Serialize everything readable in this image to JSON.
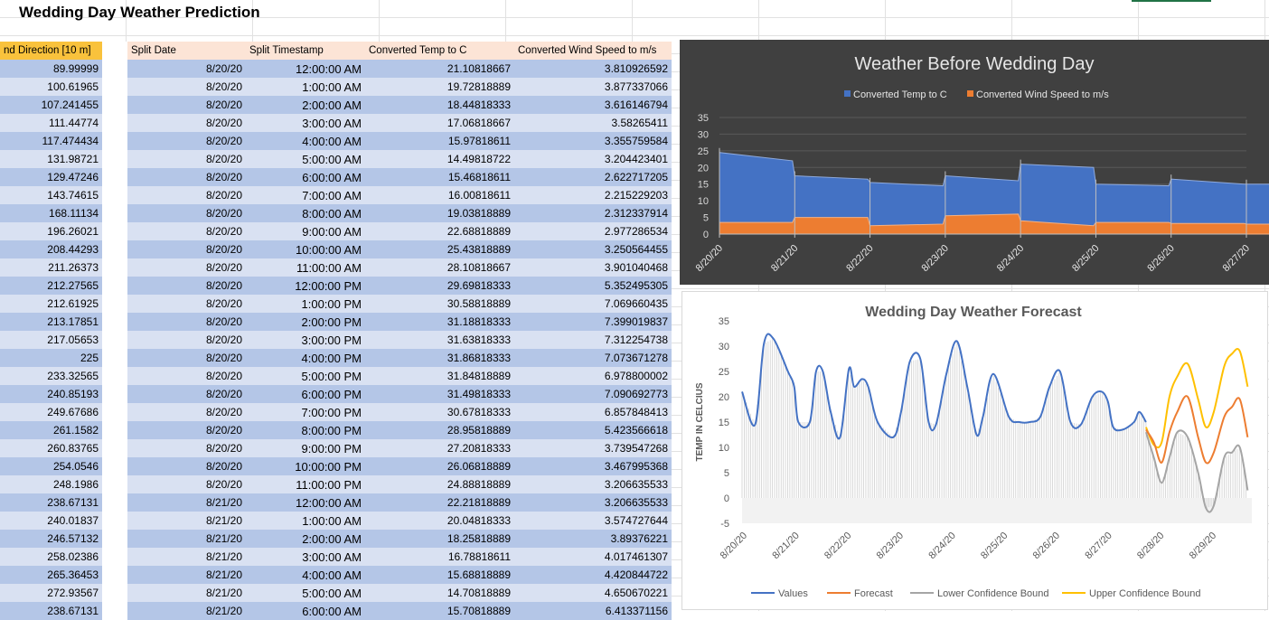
{
  "sheet": {
    "title": "Wedding Day Weather Prediction",
    "headers": [
      "nd Direction [10 m]",
      "Split Date",
      "Split Timestamp",
      "Converted Temp to C",
      "Converted Wind Speed to m/s"
    ],
    "rows": [
      [
        "89.99999",
        "8/20/20",
        "12:00:00 AM",
        "21.10818667",
        "3.810926592"
      ],
      [
        "100.61965",
        "8/20/20",
        "1:00:00 AM",
        "19.72818889",
        "3.877337066"
      ],
      [
        "107.241455",
        "8/20/20",
        "2:00:00 AM",
        "18.44818333",
        "3.616146794"
      ],
      [
        "111.44774",
        "8/20/20",
        "3:00:00 AM",
        "17.06818667",
        "3.58265411"
      ],
      [
        "117.474434",
        "8/20/20",
        "4:00:00 AM",
        "15.97818611",
        "3.355759584"
      ],
      [
        "131.98721",
        "8/20/20",
        "5:00:00 AM",
        "14.49818722",
        "3.204423401"
      ],
      [
        "129.47246",
        "8/20/20",
        "6:00:00 AM",
        "15.46818611",
        "2.622717205"
      ],
      [
        "143.74615",
        "8/20/20",
        "7:00:00 AM",
        "16.00818611",
        "2.215229203"
      ],
      [
        "168.11134",
        "8/20/20",
        "8:00:00 AM",
        "19.03818889",
        "2.312337914"
      ],
      [
        "196.26021",
        "8/20/20",
        "9:00:00 AM",
        "22.68818889",
        "2.977286534"
      ],
      [
        "208.44293",
        "8/20/20",
        "10:00:00 AM",
        "25.43818889",
        "3.250564455"
      ],
      [
        "211.26373",
        "8/20/20",
        "11:00:00 AM",
        "28.10818667",
        "3.901040468"
      ],
      [
        "212.27565",
        "8/20/20",
        "12:00:00 PM",
        "29.69818333",
        "5.352495305"
      ],
      [
        "212.61925",
        "8/20/20",
        "1:00:00 PM",
        "30.58818889",
        "7.069660435"
      ],
      [
        "213.17851",
        "8/20/20",
        "2:00:00 PM",
        "31.18818333",
        "7.399019837"
      ],
      [
        "217.05653",
        "8/20/20",
        "3:00:00 PM",
        "31.63818333",
        "7.312254738"
      ],
      [
        "225",
        "8/20/20",
        "4:00:00 PM",
        "31.86818333",
        "7.073671278"
      ],
      [
        "233.32565",
        "8/20/20",
        "5:00:00 PM",
        "31.84818889",
        "6.978800002"
      ],
      [
        "240.85193",
        "8/20/20",
        "6:00:00 PM",
        "31.49818333",
        "7.090692773"
      ],
      [
        "249.67686",
        "8/20/20",
        "7:00:00 PM",
        "30.67818333",
        "6.857848413"
      ],
      [
        "261.1582",
        "8/20/20",
        "8:00:00 PM",
        "28.95818889",
        "5.423566618"
      ],
      [
        "260.83765",
        "8/20/20",
        "9:00:00 PM",
        "27.20818333",
        "3.739547268"
      ],
      [
        "254.0546",
        "8/20/20",
        "10:00:00 PM",
        "26.06818889",
        "3.467995368"
      ],
      [
        "248.1986",
        "8/20/20",
        "11:00:00 PM",
        "24.88818889",
        "3.206635533"
      ],
      [
        "238.67131",
        "8/21/20",
        "12:00:00 AM",
        "22.21818889",
        "3.206635533"
      ],
      [
        "240.01837",
        "8/21/20",
        "1:00:00 AM",
        "20.04818333",
        "3.574727644"
      ],
      [
        "246.57132",
        "8/21/20",
        "2:00:00 AM",
        "18.25818889",
        "3.89376221"
      ],
      [
        "258.02386",
        "8/21/20",
        "3:00:00 AM",
        "16.78818611",
        "4.017461307"
      ],
      [
        "265.36453",
        "8/21/20",
        "4:00:00 AM",
        "15.68818889",
        "4.420844722"
      ],
      [
        "272.93567",
        "8/21/20",
        "5:00:00 AM",
        "14.70818889",
        "4.650670221"
      ],
      [
        "238.67131",
        "8/21/20",
        "6:00:00 AM",
        "15.70818889",
        "6.413371156"
      ]
    ]
  },
  "chart_data": [
    {
      "type": "area",
      "title": "Weather Before Wedding Day",
      "categories": [
        "8/20/20",
        "8/21/20",
        "8/22/20",
        "8/23/20",
        "8/24/20",
        "8/25/20",
        "8/26/20",
        "8/27/20"
      ],
      "x": [
        0,
        0.97,
        1.0,
        1.97,
        2.0,
        2.97,
        3.0,
        3.97,
        4.0,
        4.97,
        5.0,
        5.97,
        6.0,
        6.97,
        7.0,
        7.97
      ],
      "series": [
        {
          "name": "Converted Temp to C",
          "color": "#4472c4",
          "values": [
            24.5,
            22,
            17.5,
            16.5,
            15.5,
            14.5,
            17.5,
            16,
            21,
            20,
            15,
            14.5,
            16.5,
            15,
            15,
            15
          ]
        },
        {
          "name": "Converted Wind Speed to m/s",
          "color": "#ed7d31",
          "values": [
            3.5,
            3.5,
            5,
            5,
            2.5,
            3,
            5.5,
            6,
            4,
            2.5,
            3.5,
            3.5,
            3.2,
            3.2,
            3,
            3
          ]
        }
      ],
      "ylim": [
        0,
        35
      ],
      "yticks": [
        0,
        5,
        10,
        15,
        20,
        25,
        30,
        35
      ],
      "legend": "top",
      "grid": true
    },
    {
      "type": "line",
      "title": "Wedding Day Weather Forecast",
      "ylabel": "TEMP IN CELCIUS",
      "categories": [
        "8/20/20",
        "8/21/20",
        "8/22/20",
        "8/23/20",
        "8/24/20",
        "8/25/20",
        "8/26/20",
        "8/27/20",
        "8/28/20",
        "8/29/20"
      ],
      "ylim": [
        -5,
        35
      ],
      "yticks": [
        -5,
        0,
        5,
        10,
        15,
        20,
        25,
        30,
        35
      ],
      "series": [
        {
          "name": "Values",
          "color": "#4472c4",
          "x": [
            0,
            0.25,
            0.42,
            0.6,
            0.88,
            1.0,
            1.08,
            1.3,
            1.42,
            1.55,
            1.7,
            1.88,
            2.05,
            2.15,
            2.3,
            2.42,
            2.6,
            2.9,
            3.05,
            3.22,
            3.42,
            3.58,
            3.72,
            3.92,
            4.12,
            4.32,
            4.5,
            4.62,
            4.82,
            5.12,
            5.32,
            5.52,
            5.72,
            5.9,
            6.1,
            6.3,
            6.5,
            6.72,
            6.9,
            7.02,
            7.12,
            7.3,
            7.52,
            7.62,
            7.75
          ],
          "values": [
            21,
            14.5,
            30.5,
            31.5,
            25,
            22,
            15,
            15,
            25,
            25,
            17,
            12,
            25.5,
            22,
            23.5,
            22,
            15,
            12,
            17,
            27,
            27.5,
            15,
            14.5,
            24.5,
            31,
            22,
            12.5,
            16,
            24.5,
            16,
            15,
            15,
            16,
            22,
            25,
            15,
            14.5,
            20,
            21,
            19,
            14,
            13.5,
            15,
            17,
            15
          ]
        },
        {
          "name": "Forecast",
          "color": "#ed7d31",
          "x": [
            7.75,
            7.9,
            8.05,
            8.2,
            8.35,
            8.55,
            8.75,
            8.9,
            9.05,
            9.25,
            9.4,
            9.55,
            9.7
          ],
          "values": [
            13.5,
            11,
            7,
            13,
            17,
            20,
            12,
            7,
            9,
            16,
            18,
            19.5,
            12
          ]
        },
        {
          "name": "Lower Confidence Bound",
          "color": "#a5a5a5",
          "x": [
            7.75,
            7.9,
            8.05,
            8.2,
            8.35,
            8.55,
            8.75,
            8.9,
            9.05,
            9.25,
            9.4,
            9.55,
            9.7
          ],
          "values": [
            13,
            8,
            3,
            8,
            13,
            12,
            5,
            -2,
            -1.5,
            8,
            9,
            10,
            1.5
          ]
        },
        {
          "name": "Upper Confidence Bound",
          "color": "#ffc000",
          "x": [
            7.75,
            7.9,
            8.05,
            8.2,
            8.35,
            8.55,
            8.75,
            8.9,
            9.05,
            9.25,
            9.4,
            9.55,
            9.7
          ],
          "values": [
            14,
            10.5,
            11,
            20,
            24,
            26.5,
            19.5,
            14,
            17,
            26,
            28.5,
            29,
            22
          ]
        }
      ],
      "legend": "bottom"
    }
  ]
}
